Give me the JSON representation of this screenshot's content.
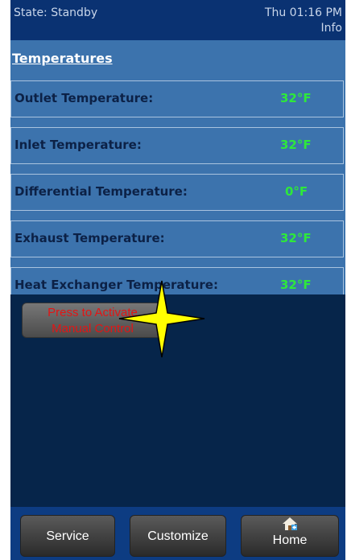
{
  "status": {
    "state": "State: Standby",
    "datetime": "Thu 01:16 PM",
    "info": "Info"
  },
  "section_title": "Temperatures",
  "temperatures": [
    {
      "label": "Outlet Temperature:",
      "value": "32°F"
    },
    {
      "label": "Inlet Temperature:",
      "value": "32°F"
    },
    {
      "label": "Differential Temperature:",
      "value": "0°F"
    },
    {
      "label": "Exhaust Temperature:",
      "value": "32°F"
    },
    {
      "label": "Heat Exchanger Temperature:",
      "value": "32°F"
    }
  ],
  "manual_control": {
    "line1": "Press to Activate",
    "line2": "Manual Control"
  },
  "footer": {
    "service": "Service",
    "customize": "Customize",
    "home": "Home"
  },
  "icons": {
    "home": "home-icon",
    "click_marker": "star-marker-icon"
  },
  "colors": {
    "value_green": "#2ee83b",
    "manual_text_red": "#e21515",
    "panel_blue": "#3c73ad",
    "status_bar": "#0a3272",
    "marker_yellow": "#ffff00"
  }
}
